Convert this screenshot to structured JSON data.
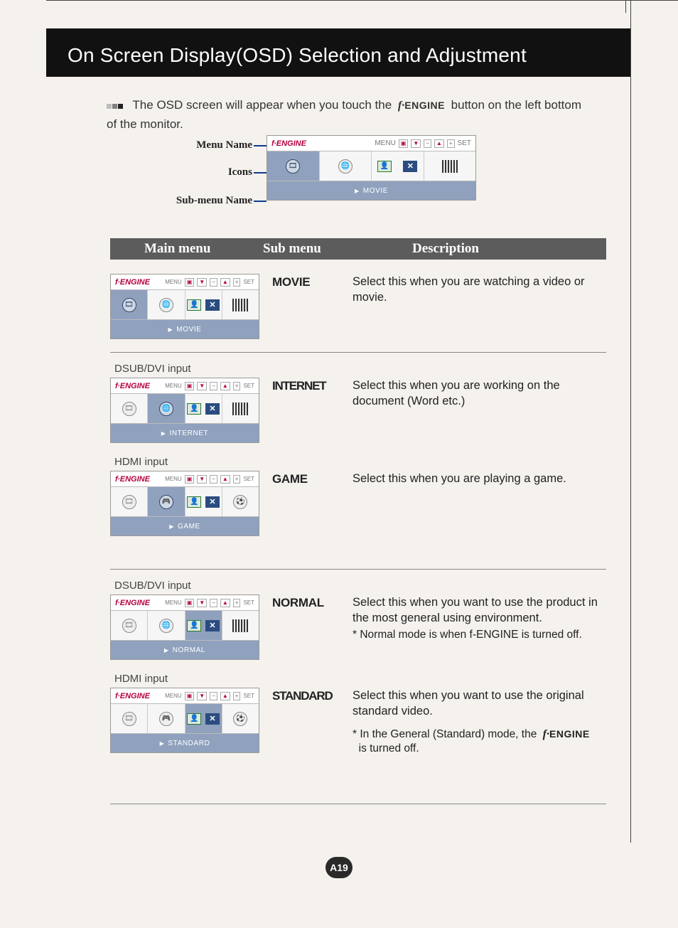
{
  "header": {
    "title": "On Screen Display(OSD) Selection and Adjustment"
  },
  "intro": {
    "part1": "The OSD screen will appear when you touch the",
    "fengine_btn": "ENGINE",
    "part2": "button on the left bottom of the monitor."
  },
  "diagram": {
    "labels": {
      "menu_name": "Menu Name",
      "icons": "Icons",
      "sub_menu_name": "Sub-menu Name"
    },
    "osd": {
      "title": "ENGINE",
      "menu_lbl": "MENU",
      "set_lbl": "SET",
      "footer": "MOVIE"
    }
  },
  "table_header": {
    "col1": "Main menu",
    "col2": "Sub menu",
    "col3": "Description"
  },
  "rows": {
    "movie": {
      "sub": "MOVIE",
      "desc": "Select this when you are watching a video or movie.",
      "osd_footer": "MOVIE"
    },
    "internet": {
      "label_top": "DSUB/DVI input",
      "sub": "INTERNET",
      "desc": "Select this when you are working on the document (Word etc.)",
      "osd_footer": "INTERNET"
    },
    "game": {
      "label_top": "HDMI input",
      "sub": "GAME",
      "desc": "Select this when you are playing a game.",
      "osd_footer": "GAME"
    },
    "normal": {
      "label_top": "DSUB/DVI input",
      "sub": "NORMAL",
      "desc": "Select this when you want to use the product in the most general using environment.",
      "note": "* Normal mode is when f-ENGINE is turned off.",
      "osd_footer": "NORMAL"
    },
    "standard": {
      "label_top": "HDMI input",
      "sub": "STANDARD",
      "desc": "Select this when you want to use the original standard video.",
      "note1": "* In the General (Standard) mode, the",
      "note2_eng": "ENGINE",
      "note3": "is turned off.",
      "osd_footer": "STANDARD"
    }
  },
  "page_number": "A19"
}
